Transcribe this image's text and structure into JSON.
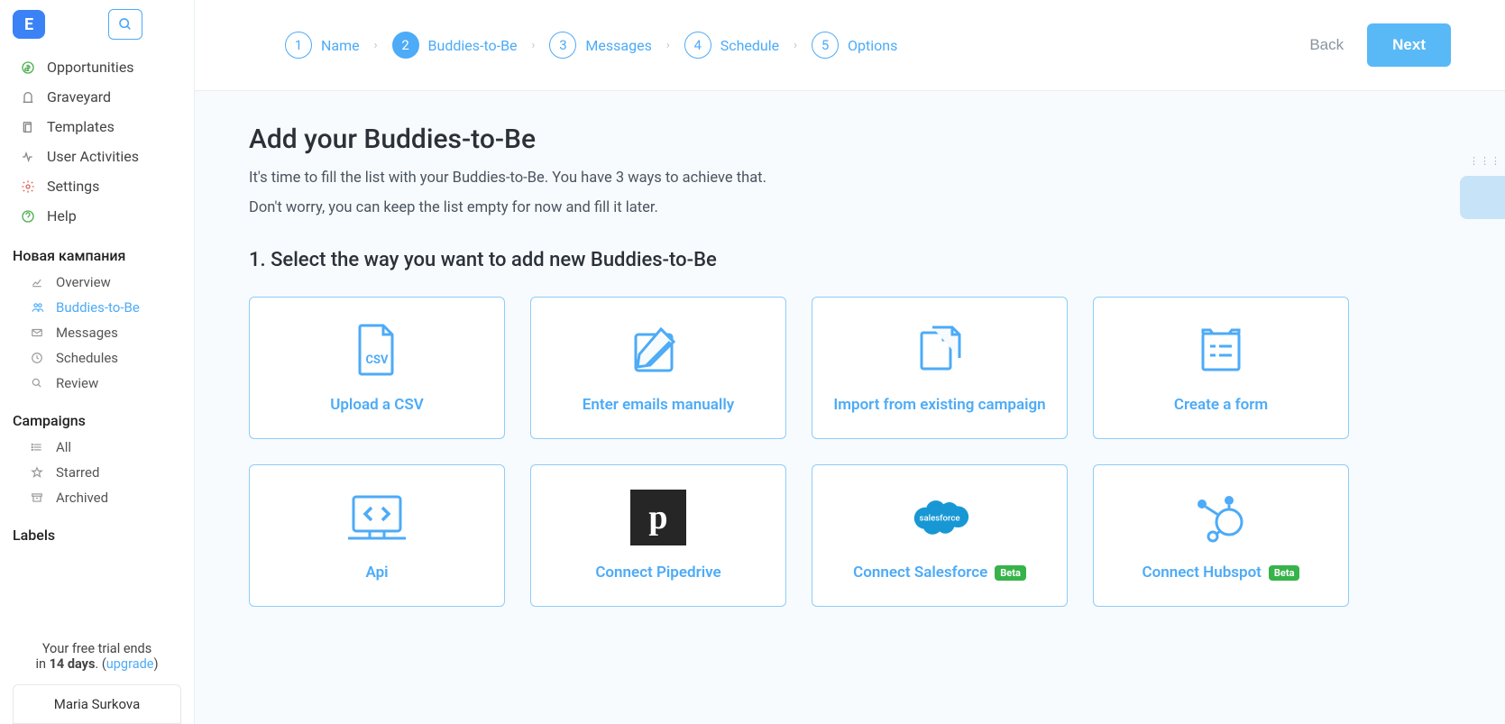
{
  "logo_letter": "E",
  "sidebar_nav": [
    {
      "label": "Opportunities",
      "icon": "dollar-icon"
    },
    {
      "label": "Graveyard",
      "icon": "grave-icon"
    },
    {
      "label": "Templates",
      "icon": "templates-icon"
    },
    {
      "label": "User Activities",
      "icon": "activity-icon"
    },
    {
      "label": "Settings",
      "icon": "settings-icon"
    },
    {
      "label": "Help",
      "icon": "help-icon"
    }
  ],
  "campaign_section_title": "Новая кампания",
  "campaign_nav": [
    {
      "label": "Overview",
      "icon": "chart-icon",
      "active": false
    },
    {
      "label": "Buddies-to-Be",
      "icon": "people-icon",
      "active": true
    },
    {
      "label": "Messages",
      "icon": "mail-icon",
      "active": false
    },
    {
      "label": "Schedules",
      "icon": "clock-icon",
      "active": false
    },
    {
      "label": "Review",
      "icon": "search-small-icon",
      "active": false
    }
  ],
  "campaigns_section_title": "Campaigns",
  "campaigns_nav": [
    {
      "label": "All",
      "icon": "list-icon"
    },
    {
      "label": "Starred",
      "icon": "star-icon"
    },
    {
      "label": "Archived",
      "icon": "archive-icon"
    }
  ],
  "labels_section_title": "Labels",
  "trial": {
    "line1": "Your free trial ends",
    "prefix": "in ",
    "days": "14 days",
    "suffix": ". (",
    "upgrade": "upgrade",
    "close": ")"
  },
  "user_name": "Maria Surkova",
  "stepper": [
    {
      "num": "1",
      "label": "Name"
    },
    {
      "num": "2",
      "label": "Buddies-to-Be"
    },
    {
      "num": "3",
      "label": "Messages"
    },
    {
      "num": "4",
      "label": "Schedule"
    },
    {
      "num": "5",
      "label": "Options"
    }
  ],
  "active_step": 2,
  "back_label": "Back",
  "next_label": "Next",
  "heading": "Add your Buddies-to-Be",
  "para1": "It's time to fill the list with your Buddies-to-Be. You have 3 ways to achieve that.",
  "para2": "Don't worry, you can keep the list empty for now and fill it later.",
  "subheading": "1. Select the way you want to add new Buddies-to-Be",
  "cards": [
    {
      "label": "Upload a CSV",
      "icon": "csv"
    },
    {
      "label": "Enter emails manually",
      "icon": "edit"
    },
    {
      "label": "Import from existing campaign",
      "icon": "copy"
    },
    {
      "label": "Create a form",
      "icon": "form"
    },
    {
      "label": "Api",
      "icon": "api"
    },
    {
      "label": "Connect Pipedrive",
      "icon": "pipedrive"
    },
    {
      "label": "Connect Salesforce",
      "icon": "salesforce",
      "badge": "Beta"
    },
    {
      "label": "Connect Hubspot",
      "icon": "hubspot",
      "badge": "Beta"
    }
  ],
  "csv_text": "CSV",
  "salesforce_text": "salesforce"
}
